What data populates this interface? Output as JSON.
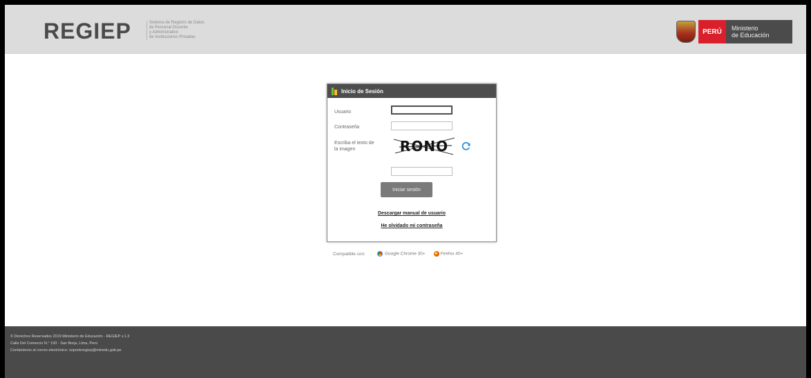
{
  "header": {
    "brand": "REGIEP",
    "brand_sub": [
      "Sistema de Registro de Datos",
      "de Personal Docente",
      "y Administrativo",
      "de Instituciones Privadas"
    ],
    "peru_label": "PERÚ",
    "ministry_line1": "Ministerio",
    "ministry_line2": "de Educación"
  },
  "login": {
    "title": "Inicio de Sesión",
    "user_label": "Usuario",
    "user_value": "",
    "password_label": "Contraseña",
    "password_value": "",
    "captcha_label": "Escriba el texto de la imagen",
    "captcha_text": "RONO",
    "captcha_value": "",
    "submit_label": "Iniciar sesión",
    "manual_link": "Descargar manual de usuario",
    "forgot_link": "He olvidado mi contraseña"
  },
  "compat": {
    "label": "Compatible con:",
    "chrome": "Google Chrome 30+",
    "firefox": "Firefox 40+"
  },
  "footer": {
    "line1": "© Derechos Reservados 2019 Ministerio de Educación - REGIEP v.1.3",
    "line2": "Calle Del Comercio N.° 193 - San Borja, Lima, Perú",
    "line3": "Contáctenos al correo electrónico: soporteregiep@minedu.gob.pe"
  },
  "colors": {
    "header_bg": "#dcdcdc",
    "panel_head": "#4d4d4d",
    "footer_bg": "#4a4a4a",
    "peru_red": "#d91f2b",
    "button_bg": "#7a7a7a"
  }
}
